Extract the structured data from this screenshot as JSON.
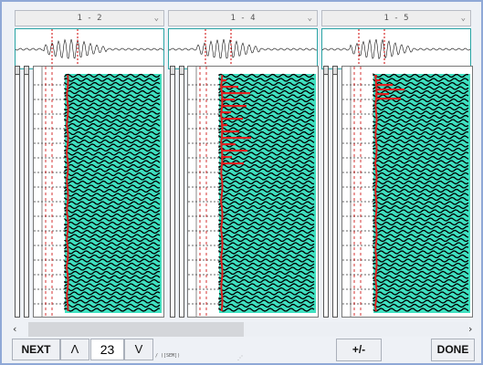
{
  "panels": [
    {
      "id": "1-2",
      "label": "1 - 2",
      "picks": [
        true,
        false,
        false
      ]
    },
    {
      "id": "1-4",
      "label": "1 - 4",
      "picks": [
        true,
        false,
        false
      ]
    },
    {
      "id": "1-5",
      "label": "1 - 5",
      "picks": [
        true,
        false,
        false
      ]
    }
  ],
  "controls": {
    "next_label": "NEXT",
    "up_label": "Λ",
    "counter_value": "23",
    "down_label": "V",
    "plusminus_label": "+/-",
    "done_label": "DONE",
    "status_text": "/ ([SEM])",
    "scroll_left": "‹",
    "scroll_right": "›",
    "scroll_position": 0.49
  },
  "colors": {
    "fill": "#3fe0c0",
    "trace": "#000000",
    "pick": "#e02020",
    "reference_line": "#cc0000",
    "wave_frame": "#2aa5a5"
  }
}
